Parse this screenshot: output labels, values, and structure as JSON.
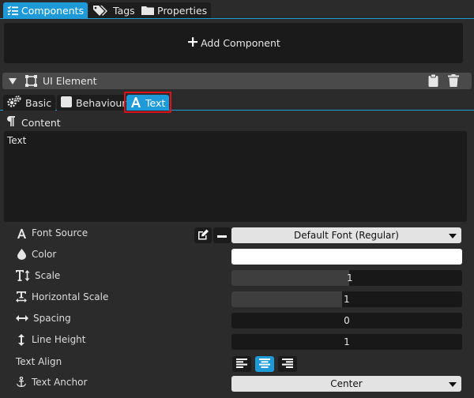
{
  "top_tabs": [
    {
      "label": "Components",
      "icon": "checklist-icon",
      "active": true
    },
    {
      "label": "Tags",
      "icon": "tags-icon",
      "active": false
    },
    {
      "label": "Properties",
      "icon": "folder-icon",
      "active": false
    }
  ],
  "add_component": {
    "label": "Add Component"
  },
  "ui_element": {
    "title": "UI Element"
  },
  "sub_tabs": [
    {
      "label": "Basic",
      "icon": "gears-icon",
      "active": false
    },
    {
      "label": "Behaviour",
      "icon": "square-icon",
      "active": false
    },
    {
      "label": "Text",
      "icon": "font-icon",
      "active": true
    }
  ],
  "content": {
    "label": "Content",
    "value": "Text"
  },
  "properties": {
    "font_source": {
      "label": "Font Source",
      "value": "Default Font (Regular)"
    },
    "color": {
      "label": "Color",
      "value": "#ffffff"
    },
    "scale": {
      "label": "Scale",
      "value": "1",
      "fill_fraction": 0.51
    },
    "horizontal_scale": {
      "label": "Horizontal Scale",
      "value": "1",
      "fill_fraction": 0.48
    },
    "spacing": {
      "label": "Spacing",
      "value": "0"
    },
    "line_height": {
      "label": "Line Height",
      "value": "1"
    },
    "text_align": {
      "label": "Text Align",
      "options": [
        "left",
        "center",
        "right"
      ],
      "selected": "center"
    },
    "text_anchor": {
      "label": "Text Anchor",
      "value": "Center"
    }
  },
  "colors": {
    "accent": "#1e9ad9",
    "highlight": "#e0101a",
    "panel": "#1b1b1b",
    "background": "#2b2b2b"
  }
}
